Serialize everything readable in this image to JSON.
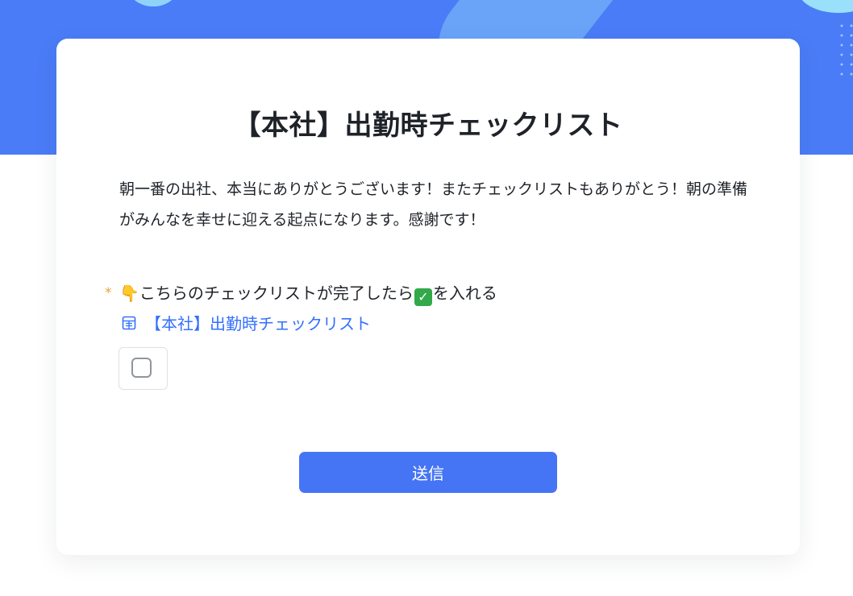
{
  "form": {
    "title": "【本社】出勤時チェックリスト",
    "description": "朝一番の出社、本当にありがとうございます！またチェックリストもありがとう！朝の準備がみんなを幸せに迎える起点になります。感謝です！",
    "question": {
      "required_mark": "*",
      "label_emoji": "👇",
      "label_before": "こちらのチェックリストが完了したら",
      "label_check_emoji": "✓",
      "label_after": "を入れる",
      "link_text": "【本社】出勤時チェックリスト",
      "link_icon": "grid-document-icon",
      "checkbox_checked": false
    },
    "submit_label": "送信"
  },
  "colors": {
    "header_blue": "#4a7cf7",
    "accent": "#3370ff",
    "button": "#4574f5",
    "required": "#e8a33d",
    "check_emoji_green": "#32a94a"
  }
}
